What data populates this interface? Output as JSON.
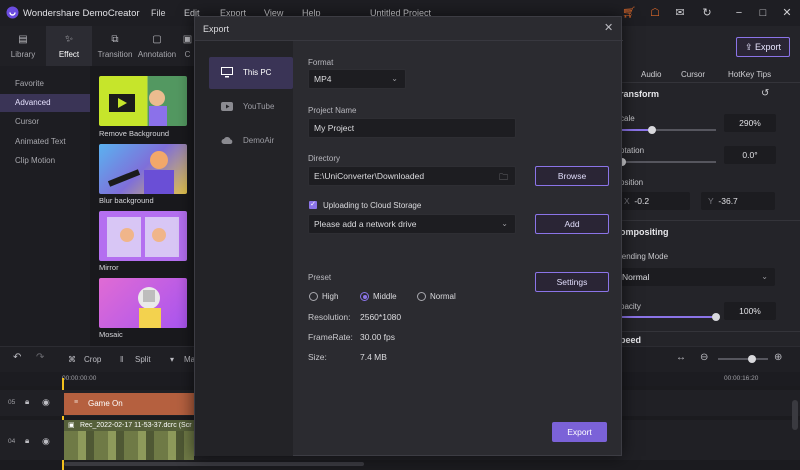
{
  "app": {
    "title": "Wondershare DemoCreator",
    "project_title": "Untitled Project",
    "menu": [
      "File",
      "Edit",
      "Export",
      "View",
      "Help"
    ],
    "export_button": "Export"
  },
  "left_tabs": [
    {
      "label": "Library",
      "icon": "library-icon"
    },
    {
      "label": "Effect",
      "icon": "effect-icon"
    },
    {
      "label": "Transition",
      "icon": "transition-icon"
    },
    {
      "label": "Annotation",
      "icon": "annotation-icon"
    },
    {
      "label": "C",
      "icon": "caption-icon"
    }
  ],
  "effect_categories": [
    "Favorite",
    "Advanced",
    "Cursor",
    "Animated Text",
    "Clip Motion"
  ],
  "effects": [
    "Remove Background",
    "Blur background",
    "Mirror",
    "Mosaic"
  ],
  "right_panel": {
    "tabs": [
      "Audio",
      "Cursor",
      "HotKey Tips"
    ],
    "transform": "ransform",
    "scale_label": "cale",
    "scale_value": "290%",
    "rotation_label": "otation",
    "rotation_value": "0.0°",
    "position_label": "osition",
    "pos_x_label": "X",
    "pos_x": "-0.2",
    "pos_y_label": "Y",
    "pos_y": "-36.7",
    "compositing": "ompositing",
    "blending_label": "lending Mode",
    "blending_value": "Normal",
    "opacity_label": "pacity",
    "opacity_value": "100%",
    "speed": "peed",
    "scale_level": 0.33,
    "rotation_level": 0.02,
    "opacity_level": 1.0
  },
  "toolbar": {
    "crop": "Crop",
    "split": "Split",
    "mark": "Ma"
  },
  "timeline": {
    "time_start": "00:00:00:00",
    "time_end": "00:00:16:20",
    "tracks": [
      {
        "number": "05",
        "clip": "Game On"
      },
      {
        "number": "04",
        "clip": "Rec_2022-02-17 11-53-37.dcrc (Scr"
      }
    ]
  },
  "export_dialog": {
    "title": "Export",
    "destinations": [
      {
        "label": "This PC",
        "icon": "computer-icon"
      },
      {
        "label": "YouTube",
        "icon": "youtube-icon"
      },
      {
        "label": "DemoAir",
        "icon": "cloud-icon"
      }
    ],
    "format_label": "Format",
    "format_value": "MP4",
    "project_name_label": "Project Name",
    "project_name_value": "My Project",
    "directory_label": "Directory",
    "directory_value": "E:\\UniConverter\\Downloaded",
    "browse_button": "Browse",
    "cloud_checkbox_label": "Uploading to Cloud Storage",
    "cloud_checked": true,
    "network_drive_placeholder": "Please add a network drive",
    "add_button": "Add",
    "preset_label": "Preset",
    "settings_button": "Settings",
    "presets": [
      "High",
      "Middle",
      "Normal"
    ],
    "preset_selected": "Middle",
    "resolution_label": "Resolution:",
    "resolution_value": "2560*1080",
    "framerate_label": "FrameRate:",
    "framerate_value": "30.00 fps",
    "size_label": "Size:",
    "size_value": "7.4 MB",
    "export_button": "Export"
  },
  "colors": {
    "accent": "#8b74e8",
    "brand_red": "#e06a2a",
    "clip_orange": "#b5603f"
  }
}
